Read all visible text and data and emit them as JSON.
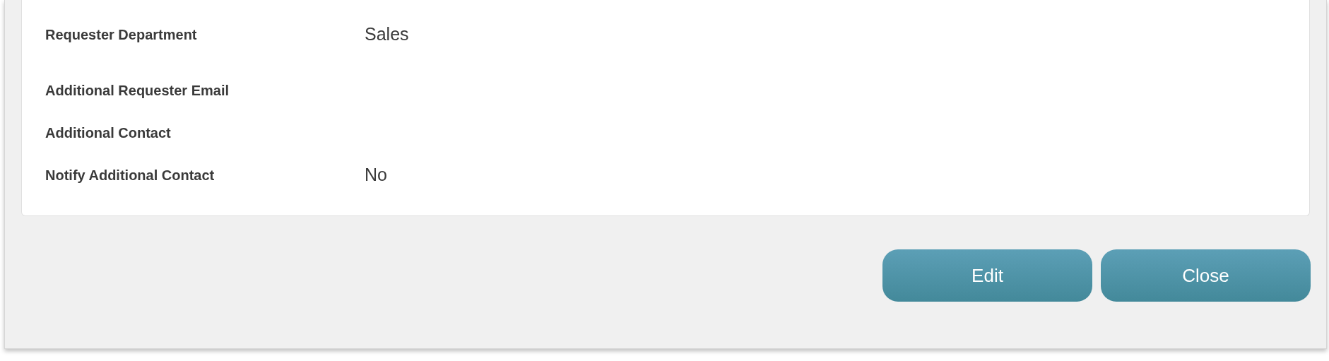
{
  "fields": [
    {
      "label": "Requester Department",
      "value": "Sales"
    },
    {
      "label": "Additional Requester Email"
    },
    {
      "label": "Additional Contact"
    },
    {
      "label": "Notify Additional Contact",
      "value": "No"
    }
  ],
  "buttons": [
    "Edit",
    "Close"
  ]
}
